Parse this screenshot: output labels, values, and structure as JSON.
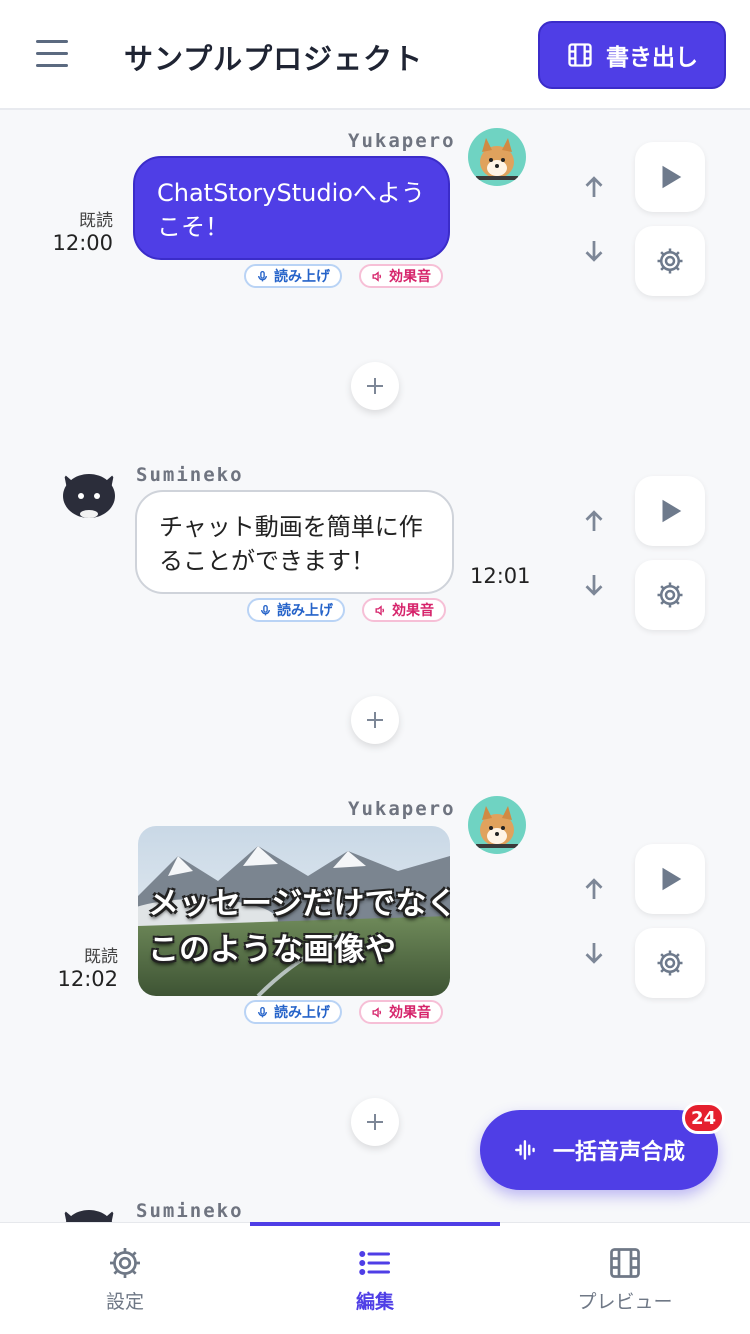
{
  "header": {
    "title": "サンプルプロジェクト",
    "export_label": "書き出し"
  },
  "messages": [
    {
      "sender": "Yukapero",
      "text": "ChatStoryStudioへようこそ！",
      "read": "既読",
      "time": "12:00",
      "voice_label": "読み上げ",
      "sfx_label": "効果音"
    },
    {
      "sender": "Sumineko",
      "text": "チャット動画を簡単に作ることができます！",
      "time": "12:01",
      "voice_label": "読み上げ",
      "sfx_label": "効果音"
    },
    {
      "sender": "Yukapero",
      "image_caption_line1": "メッセージだけでなく、",
      "image_caption_line2": "このような画像や",
      "read": "既読",
      "time": "12:02",
      "voice_label": "読み上げ",
      "sfx_label": "効果音"
    },
    {
      "sender": "Sumineko"
    }
  ],
  "fab": {
    "label": "一括音声合成",
    "badge": "24"
  },
  "tabs": [
    {
      "label": "設定",
      "icon": "gear-icon"
    },
    {
      "label": "編集",
      "icon": "list-icon",
      "active": true
    },
    {
      "label": "プレビュー",
      "icon": "film-icon"
    }
  ],
  "colors": {
    "accent": "#4f3ee6",
    "badge": "#e5202e",
    "voice": "#2563c9",
    "sfx": "#d6246b"
  }
}
